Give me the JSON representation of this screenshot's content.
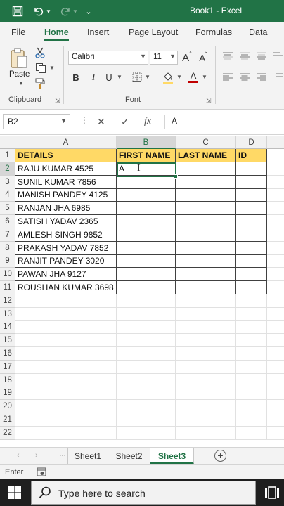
{
  "titlebar": {
    "title": "Book1  -  Excel",
    "bg": "#217346"
  },
  "tabs": [
    "File",
    "Home",
    "Insert",
    "Page Layout",
    "Formulas",
    "Data"
  ],
  "active_tab": "Home",
  "ribbon": {
    "paste_label": "Paste",
    "clipboard_label": "Clipboard",
    "font_label": "Font",
    "font_name": "Calibri",
    "font_size": "11",
    "bold": "B",
    "italic": "I",
    "underline": "U",
    "grow_font": "A",
    "shrink_font": "A",
    "font_color": "A"
  },
  "formula_bar": {
    "name_box": "B2",
    "fx": "fx",
    "value": "A"
  },
  "columns": [
    "A",
    "B",
    "C",
    "D"
  ],
  "rows": [
    "1",
    "2",
    "3",
    "4",
    "5",
    "6",
    "7",
    "8",
    "9",
    "10",
    "11",
    "12",
    "13",
    "14",
    "15",
    "16",
    "17",
    "18",
    "19",
    "20",
    "21",
    "22"
  ],
  "headers": [
    "DETAILS",
    "FIRST NAME",
    "LAST NAME",
    "ID"
  ],
  "details": [
    "RAJU KUMAR 4525",
    "SUNIL KUMAR 7856",
    "MANISH PANDEY 4125",
    "RANJAN JHA 6985",
    "SATISH YADAV 2365",
    "AMLESH SINGH 9852",
    "PRAKASH YADAV 7852",
    "RANJIT PANDEY 3020",
    "PAWAN JHA 9127",
    "ROUSHAN KUMAR 3698"
  ],
  "active_cell_value": "A",
  "sheets": [
    "Sheet1",
    "Sheet2",
    "Sheet3"
  ],
  "active_sheet": "Sheet3",
  "status": {
    "mode": "Enter"
  },
  "taskbar": {
    "search_placeholder": "Type here to search"
  },
  "colors": {
    "header_fill": "#ffd966",
    "accent": "#217346"
  }
}
